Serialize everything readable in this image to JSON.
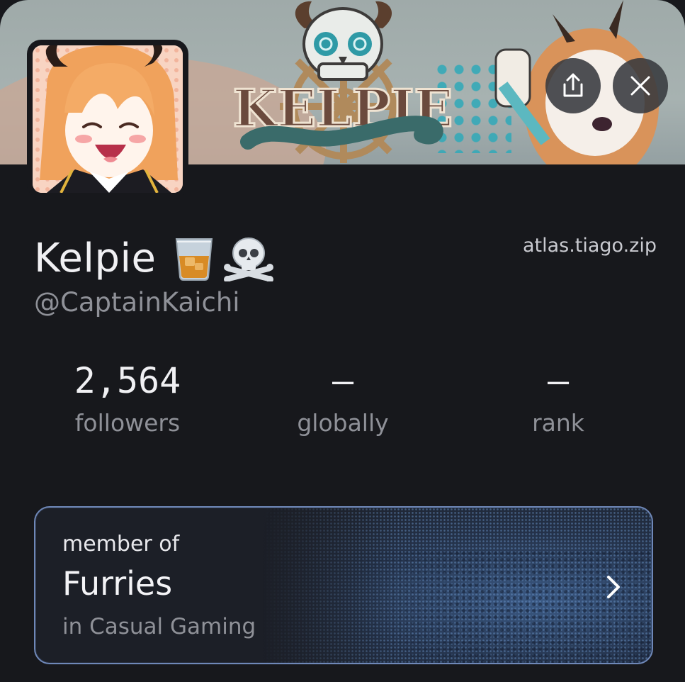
{
  "profile": {
    "banner_text": "KELPIE",
    "display_name": "Kelpie",
    "name_emojis": [
      "tumbler-glass-icon",
      "skull-crossbones-icon"
    ],
    "handle": "@CaptainKaichi",
    "domain": "atlas.tiago.zip"
  },
  "actions": {
    "share_icon": "share-icon",
    "close_icon": "close-icon"
  },
  "stats": [
    {
      "value": "2,564",
      "label": "followers"
    },
    {
      "value": "–",
      "label": "globally"
    },
    {
      "value": "–",
      "label": "rank"
    }
  ],
  "membership": {
    "eyebrow": "member of",
    "title": "Furries",
    "subtitle": "in Casual Gaming",
    "accent": "#6f88b8"
  },
  "colors": {
    "background": "#17181c",
    "text_primary": "#f0f0f3",
    "text_secondary": "#8f9198"
  }
}
